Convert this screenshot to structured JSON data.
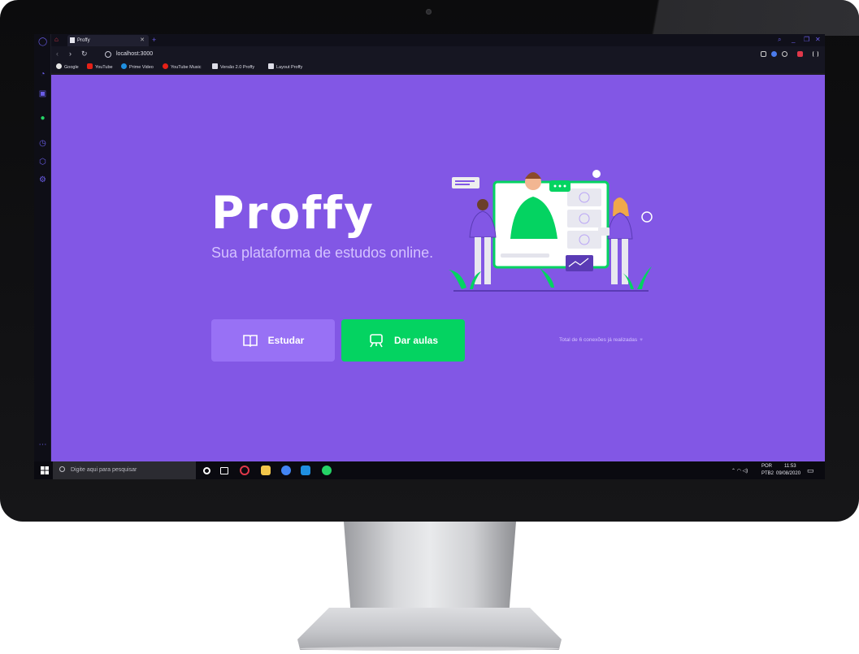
{
  "browser": {
    "tab_title": "Proffy",
    "url": "localhost:3000",
    "bookmarks": [
      "Google",
      "YouTube",
      "Prime Video",
      "YouTube Music",
      "Versão 2.0 Proffy",
      "Layout Proffy"
    ]
  },
  "page": {
    "logo_text": "Proffy",
    "tagline": "Sua plataforma de estudos online.",
    "study_button": "Estudar",
    "teach_button": "Dar aulas",
    "connections_text": "Total de 6 conexões já realizadas",
    "colors": {
      "background": "#8257e5",
      "study": "#9871f5",
      "teach": "#04d361",
      "tagline": "#d4c2ff"
    }
  },
  "taskbar": {
    "search_placeholder": "Digite aqui para pesquisar",
    "lang_top": "POR",
    "lang_bottom": "PTB2",
    "time": "11:53",
    "date": "09/08/2020"
  }
}
